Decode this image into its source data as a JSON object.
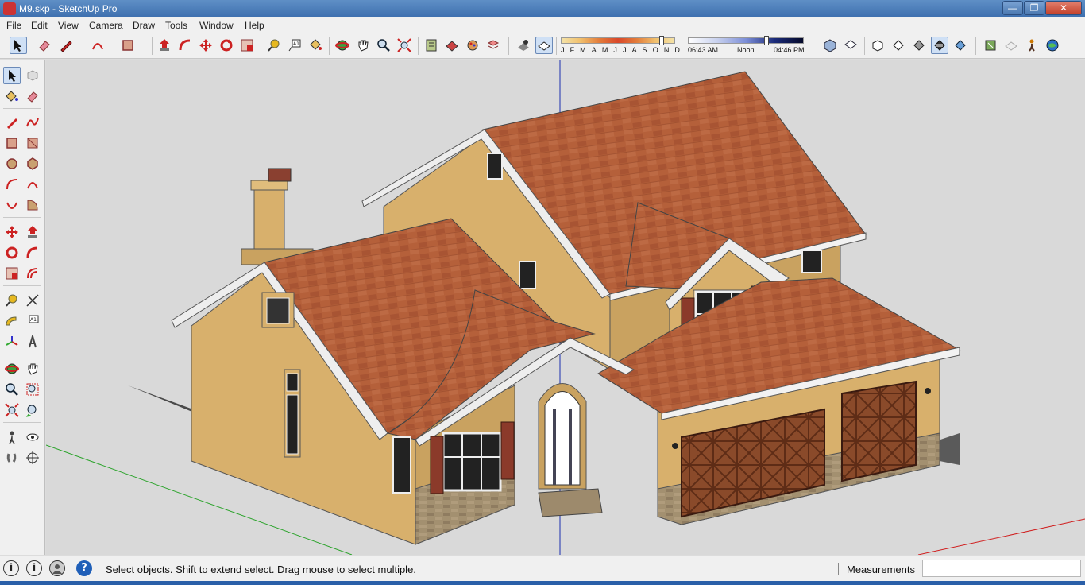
{
  "window": {
    "title": "M9.skp - SketchUp Pro",
    "minimize": "—",
    "maximize": "❐",
    "close": "✕"
  },
  "menu": [
    "File",
    "Edit",
    "View",
    "Camera",
    "Draw",
    "Tools",
    "Window",
    "Help"
  ],
  "shadows": {
    "months": [
      "J",
      "F",
      "M",
      "A",
      "M",
      "J",
      "J",
      "A",
      "S",
      "O",
      "N",
      "D"
    ],
    "time_start": "06:43 AM",
    "time_mid": "Noon",
    "time_end": "04:46 PM"
  },
  "toolbar_icons": [
    "select-icon",
    "eraser-icon",
    "pencil-icon",
    "arc-icon",
    "rectangle-icon",
    "push-pull-icon",
    "follow-me-icon",
    "move-icon",
    "rotate-icon",
    "scale-icon",
    "tape-measure-icon",
    "text-icon",
    "paint-bucket-icon",
    "orbit-icon",
    "pan-icon",
    "zoom-icon",
    "zoom-extents-icon",
    "components-icon",
    "materials-icon",
    "styles-icon",
    "layers-icon",
    "display-shadows-icon",
    "display-fog-icon",
    "iso-view-icon",
    "top-view-icon",
    "front-view-icon",
    "right-view-icon",
    "back-view-icon",
    "left-view-icon",
    "xray-icon",
    "wireframe-icon",
    "warehouse-icon",
    "extension-icon",
    "walk-icon",
    "geo-location-icon"
  ],
  "left_tools": [
    "select-icon",
    "make-component-icon",
    "paint-bucket-icon",
    "eraser-icon",
    "line-icon",
    "freehand-icon",
    "rectangle-icon",
    "rotated-rectangle-icon",
    "circle-icon",
    "polygon-icon",
    "arc-icon",
    "two-point-arc-icon",
    "three-point-arc-icon",
    "pie-icon",
    "move-icon",
    "push-pull-icon",
    "rotate-icon",
    "follow-me-icon",
    "scale-icon",
    "offset-icon",
    "tape-measure-icon",
    "dimension-icon",
    "protractor-icon",
    "text-icon",
    "axes-icon",
    "3d-text-icon",
    "orbit-icon",
    "pan-icon",
    "zoom-icon",
    "zoom-window-icon",
    "zoom-extents-icon",
    "previous-view-icon",
    "position-camera-icon",
    "look-around-icon",
    "walk-icon",
    "section-plane-icon"
  ],
  "status": {
    "message": "Select objects. Shift to extend select. Drag mouse to select multiple.",
    "measurements_label": "Measurements",
    "measurements_value": "",
    "geo_icon": "i",
    "credit_icon": "i",
    "help_icon": "?"
  },
  "colors": {
    "roof": "#b5603a",
    "wall": "#d8b06c",
    "stone": "#9d8a6c",
    "door": "#8a4a2a",
    "shutter": "#8b3a2a",
    "axis_blue": "#1c2fb0",
    "axis_green": "#2aa32a",
    "axis_red": "#d02020"
  }
}
